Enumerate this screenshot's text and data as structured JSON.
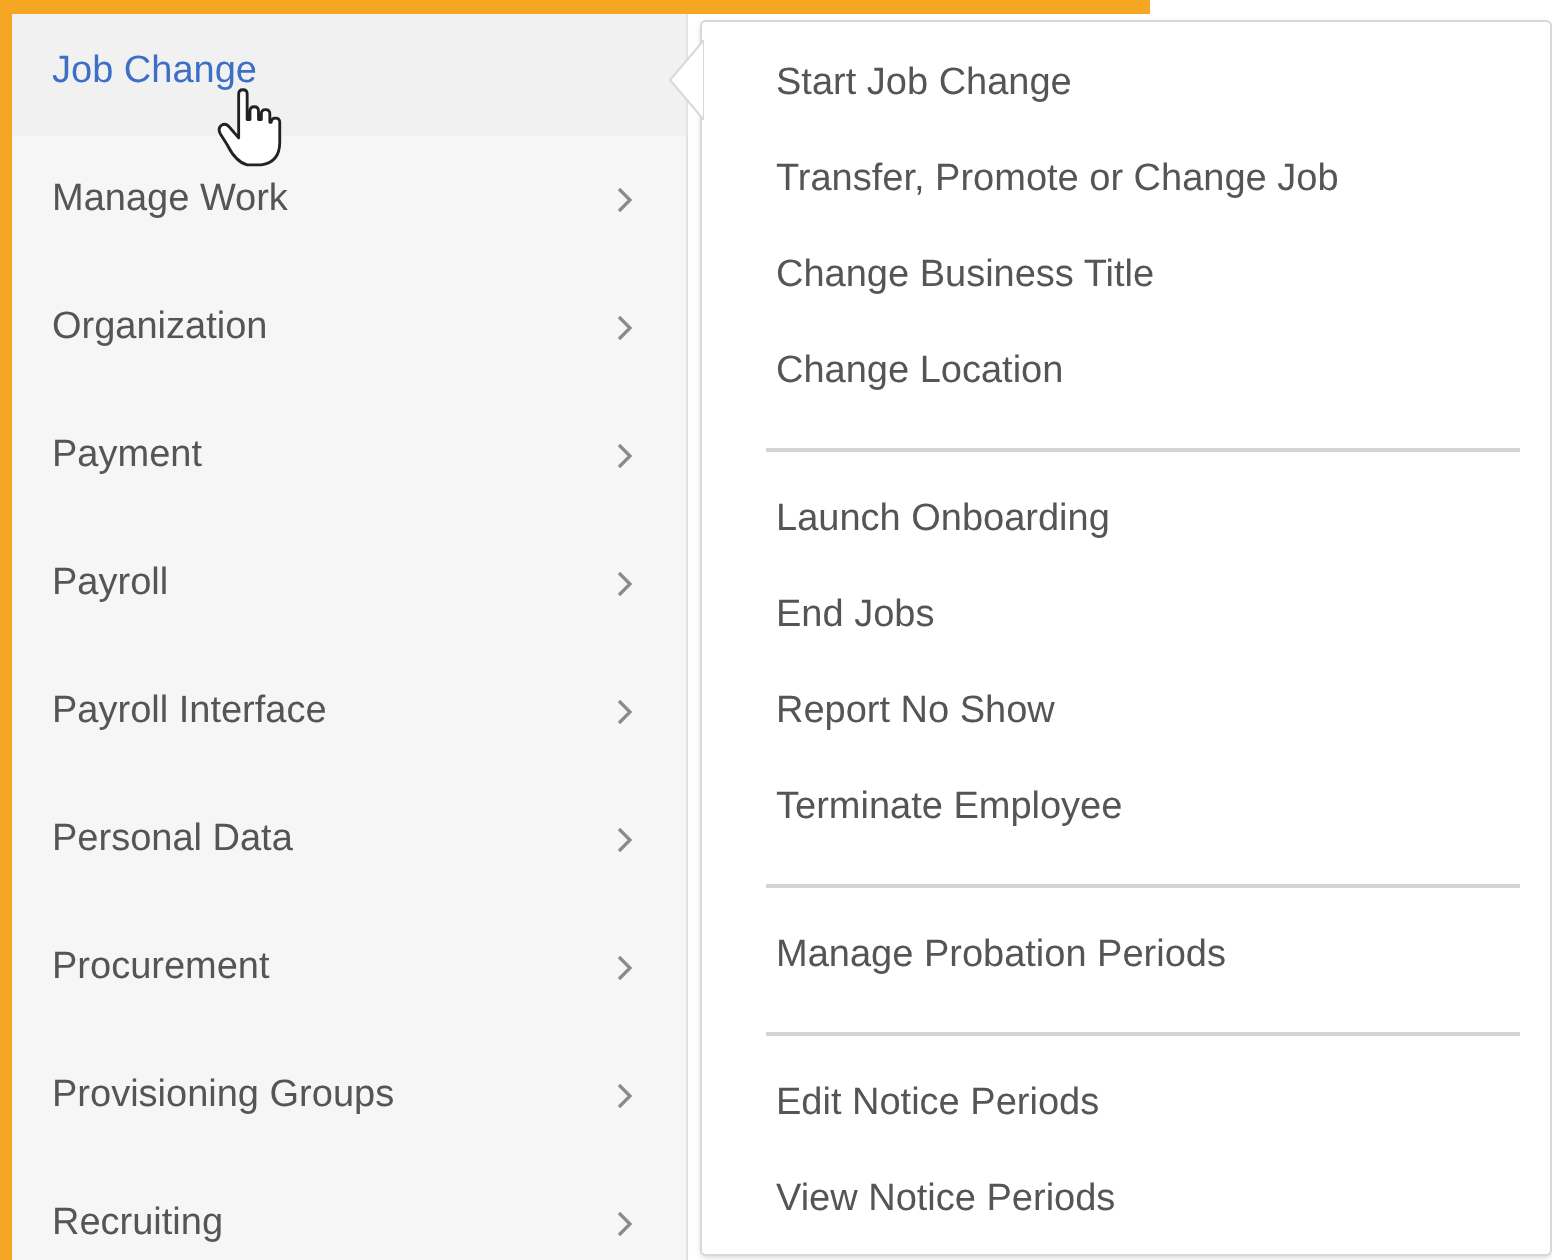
{
  "nav_menu": {
    "items": [
      {
        "label": "Job Change",
        "selected": true
      },
      {
        "label": "Manage Work",
        "selected": false
      },
      {
        "label": "Organization",
        "selected": false
      },
      {
        "label": "Payment",
        "selected": false
      },
      {
        "label": "Payroll",
        "selected": false
      },
      {
        "label": "Payroll Interface",
        "selected": false
      },
      {
        "label": "Personal Data",
        "selected": false
      },
      {
        "label": "Procurement",
        "selected": false
      },
      {
        "label": "Provisioning Groups",
        "selected": false
      },
      {
        "label": "Recruiting",
        "selected": false
      }
    ]
  },
  "submenu": {
    "groups": [
      {
        "items": [
          {
            "label": "Start Job Change"
          },
          {
            "label": "Transfer, Promote or Change Job"
          },
          {
            "label": "Change Business Title"
          },
          {
            "label": "Change Location"
          }
        ]
      },
      {
        "items": [
          {
            "label": "Launch Onboarding"
          },
          {
            "label": "End Jobs"
          },
          {
            "label": "Report No Show"
          },
          {
            "label": "Terminate Employee"
          }
        ]
      },
      {
        "items": [
          {
            "label": "Manage Probation Periods"
          }
        ]
      },
      {
        "items": [
          {
            "label": "Edit Notice Periods"
          },
          {
            "label": "View Notice Periods"
          }
        ]
      }
    ]
  }
}
